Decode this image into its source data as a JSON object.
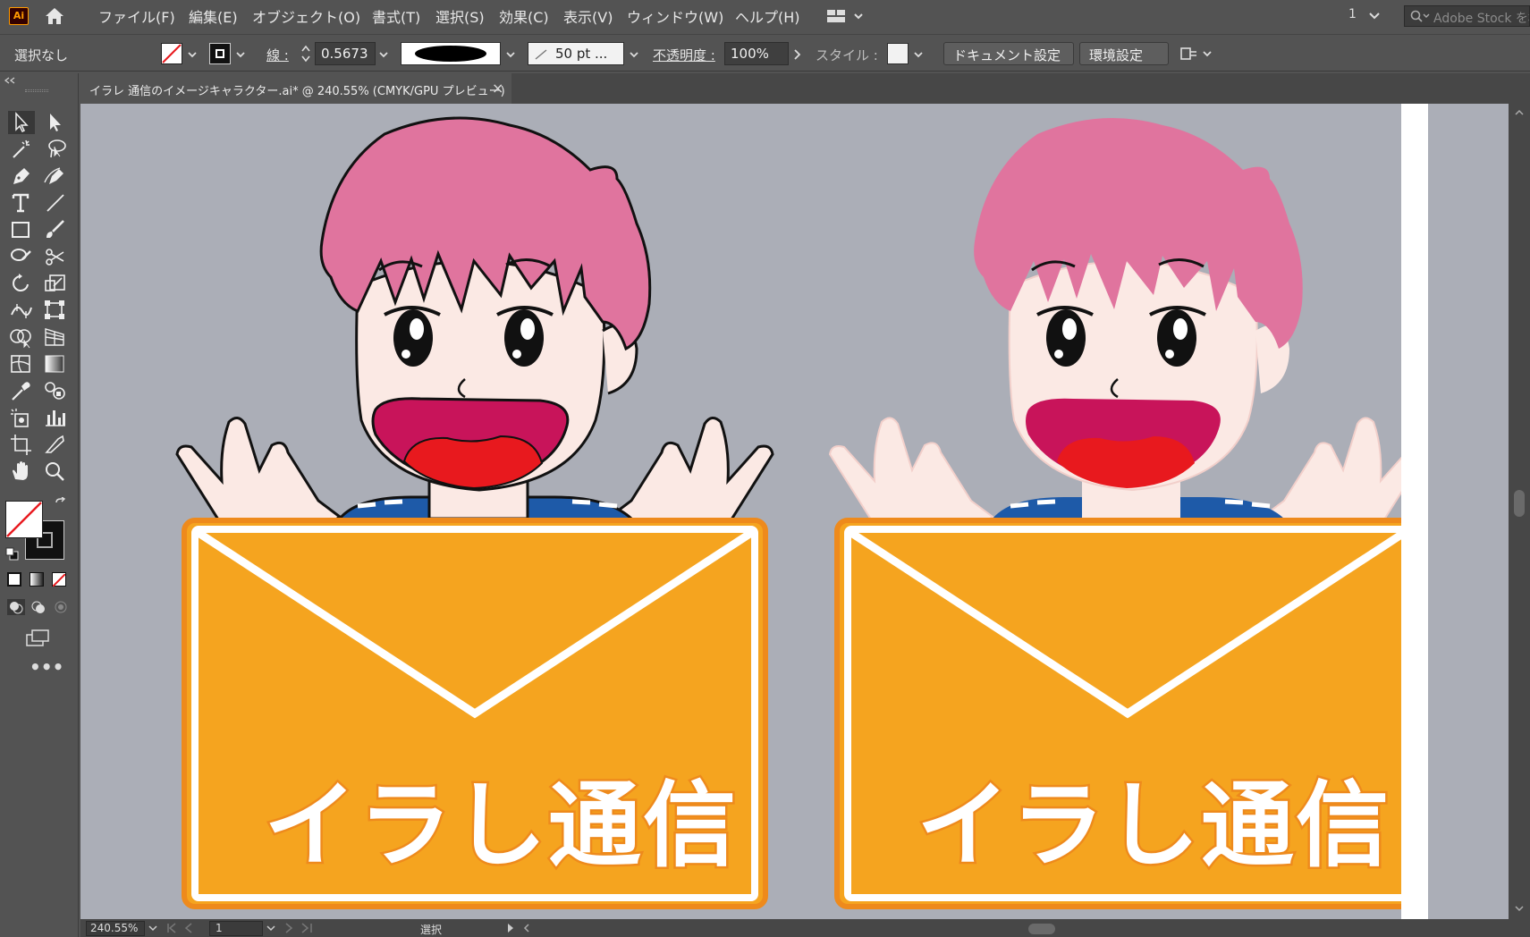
{
  "app": {
    "logo": "Ai"
  },
  "menu": {
    "items": [
      "ファイル(F)",
      "編集(E)",
      "オブジェクト(O)",
      "書式(T)",
      "選択(S)",
      "効果(C)",
      "表示(V)",
      "ウィンドウ(W)",
      "ヘルプ(H)"
    ],
    "page_indicator": "1",
    "stock_placeholder": "Adobe Stock を検索"
  },
  "control": {
    "selection": "選択なし",
    "stroke_label": "線 :",
    "stroke_value": "0.5673",
    "brush_value": "50 pt ...",
    "opacity_label": "不透明度 :",
    "opacity_value": "100%",
    "style_label": "スタイル :",
    "doc_settings": "ドキュメント設定",
    "preferences": "環境設定"
  },
  "document_tab": {
    "title": "イラレ 通信のイメージキャラクター.ai* @ 240.55% (CMYK/GPU プレビュー)",
    "close": "×"
  },
  "artwork": {
    "left_sign_text": "イラし通信",
    "right_sign_text": "イラし通信"
  },
  "colors": {
    "hair": "#e0749e",
    "skin": "#fbe9e4",
    "mouth": "#c8145a",
    "tongue": "#e8191e",
    "envelope": "#f5a41f",
    "envelope_border": "#ee8a1c",
    "shirt": "#1e5aa8",
    "canvas_bg": "#abaeb7"
  },
  "status": {
    "zoom": "240.55%",
    "page": "1",
    "state": "選択"
  }
}
